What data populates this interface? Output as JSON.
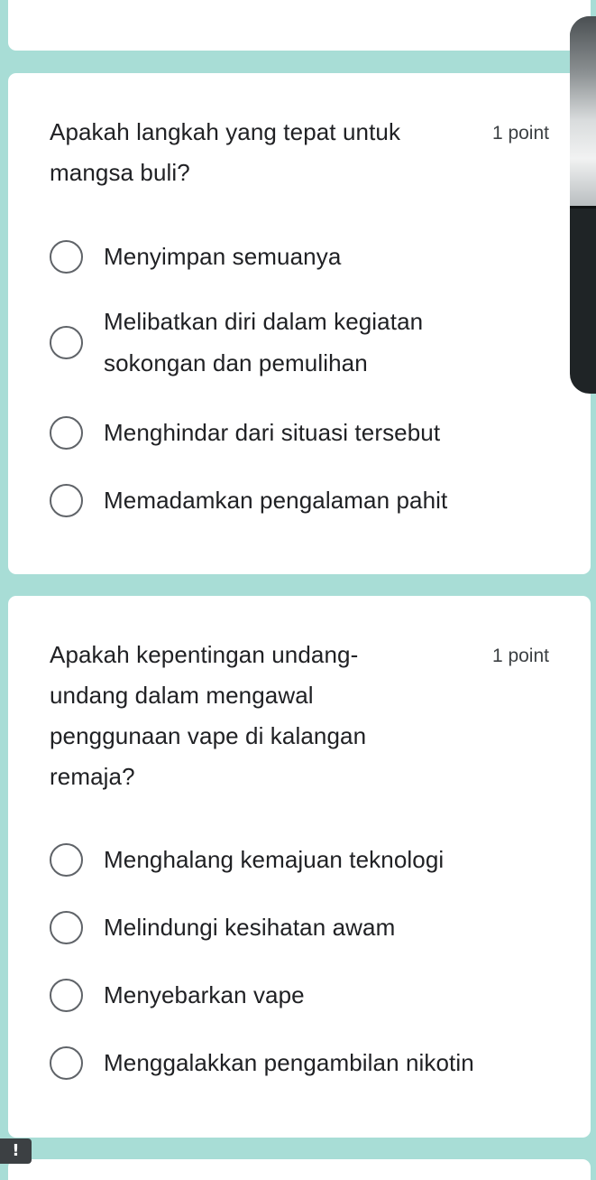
{
  "questions": [
    {
      "title": "Apakah langkah yang tepat untuk mangsa buli?",
      "points": "1 point",
      "options": [
        "Menyimpan semuanya",
        "Melibatkan diri dalam kegiatan sokongan dan pemulihan",
        "Menghindar dari situasi tersebut",
        "Memadamkan pengalaman pahit"
      ]
    },
    {
      "title": "Apakah kepentingan undang-undang dalam mengawal penggunaan vape di kalangan remaja?",
      "points": "1 point",
      "options": [
        "Menghalang kemajuan teknologi",
        "Melindungi kesihatan awam",
        "Menyebarkan vape",
        "Menggalakkan pengambilan nikotin"
      ]
    }
  ],
  "colors": {
    "background": "#a8ddd6",
    "card": "#ffffff",
    "radio_border": "#5f6368",
    "text": "#202124"
  },
  "icons": {
    "alert": "exclamation-icon"
  },
  "alert_badge": "!"
}
